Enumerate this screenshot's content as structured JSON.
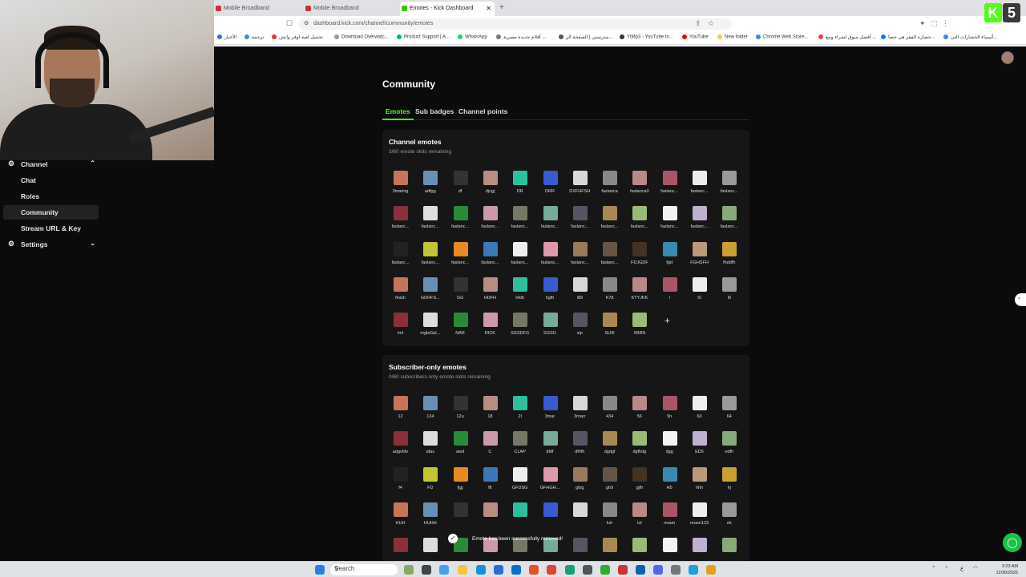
{
  "browser": {
    "tabs": [
      {
        "label": "Mobile Broadband",
        "active": false
      },
      {
        "label": "Mobile Broadband",
        "active": false
      },
      {
        "label": "Emotes - Kick Dashboard",
        "active": true
      }
    ],
    "url": "dashboard.kick.com/channel/community/emotes",
    "bookmarks": [
      "الأخبار",
      "ترجمة",
      "تحميل لعبة اوفر واتش",
      "Download Overwatc...",
      "Product Support | A...",
      "WhatsApp",
      "أفلام جديدة مصرية ...",
      "مدرستي | الصفحة الر...",
      "YtMp3 - YouTube to...",
      "YouTube",
      "New folder",
      "Chrome Web Store...",
      "أفضل سوق لشراء وبيع ...",
      "حصارة الفقر هي حصا...",
      "أسماء الحضارات التي..."
    ],
    "logo": {
      "letter": "K",
      "number": "5"
    }
  },
  "sidebar": {
    "items": [
      {
        "label": "Channel",
        "type": "parent",
        "icon": "gear-icon",
        "chevron": "⌃"
      },
      {
        "label": "Chat"
      },
      {
        "label": "Roles"
      },
      {
        "label": "Community",
        "active": true
      },
      {
        "label": "Stream URL & Key"
      },
      {
        "label": "Settings",
        "type": "parent",
        "icon": "gear-icon",
        "chevron": "⌄"
      }
    ]
  },
  "main": {
    "title": "Community",
    "tabs": [
      "Emotes",
      "Sub badges",
      "Channel points"
    ],
    "channel_emotes": {
      "heading": "Channel emotes",
      "slots": "3/60 emote slots remaining",
      "rows": [
        [
          "3maring",
          "adfgg",
          "df",
          "djcgj",
          "DR",
          "DRR",
          "DXFHFSH",
          "faslanca",
          "faslanca0",
          "faslanc...",
          "faslanc...",
          "faslanc..."
        ],
        [
          "faslanc...",
          "faslanc...",
          "faslanc...",
          "faslanc...",
          "faslanc...",
          "faslanc...",
          "faslanc...",
          "faslanc...",
          "faslanc...",
          "faslanc...",
          "faslanc...",
          "faslanc..."
        ],
        [
          "faslanc...",
          "faslanc...",
          "faslanc...",
          "faslanc...",
          "faslanc...",
          "faslanc...",
          "faslanc...",
          "faslanc...",
          "FDJGDF",
          "fgd",
          "FGHSFH",
          "fhddfh"
        ],
        [
          "finish",
          "GDHFS...",
          "GG",
          "HDFH",
          "hfdh",
          "hgfh",
          "i89",
          "K78",
          "KTYJKK",
          "l",
          "l0",
          "l9"
        ],
        [
          "iml",
          "mglsGal...",
          "NAR",
          "RICK",
          "SGSDFG",
          "SGSG",
          "sip",
          "SUIII",
          "XBBN"
        ]
      ],
      "add": "+"
    },
    "sub_emotes": {
      "heading": "Subscriber-only emotes",
      "slots": "0/60 subscribers only emote slots remaining",
      "rows": [
        [
          "12",
          "124",
          "12u",
          "18",
          "2l",
          "3mar",
          "3marr",
          "434",
          "56",
          "5h",
          "60",
          "64"
        ],
        [
          "adgvfdv",
          "afas",
          "awd",
          "C",
          "CLAP",
          "dfdf",
          "dfhfh",
          "dgdgf",
          "dgfhdg",
          "dgg",
          "ED5",
          "edfh"
        ],
        [
          "f4",
          "FD",
          "fjgj",
          "fft",
          "GFDSG",
          "GFHGH...",
          "gfsg",
          "gh9",
          "gjfh",
          "H5",
          "hhh",
          "hj"
        ],
        [
          "HUH",
          "HUHH",
          "",
          "",
          "",
          "",
          "",
          "luh",
          "lul",
          "mram",
          "mram123",
          "ok"
        ],
        [
          "",
          "",
          "",
          "",
          "",
          "",
          "",
          "",
          "",
          "",
          "",
          ""
        ]
      ]
    },
    "toast": "Emote has been successfully removed!"
  },
  "taskbar": {
    "search": "Search",
    "clock_time": "3:23 AM",
    "clock_date": "12/30/2025"
  },
  "emote_colors": [
    "#c7745a",
    "#6a8fb5",
    "#333",
    "#b98c84",
    "#2bc0a0",
    "#3a5ad0",
    "#d8d8d8",
    "#888",
    "#b88",
    "#a56",
    "#eee",
    "#999",
    "#8c2f3a",
    "#ddd",
    "#2a8a3a",
    "#c9a",
    "#776",
    "#7a9",
    "#556",
    "#a85",
    "#9b7",
    "#f2f2f2",
    "#c0b0d0",
    "#8a7",
    "#222",
    "#c2c530",
    "#e88a20",
    "#3a78b8",
    "#eee",
    "#d9a",
    "#9a7a5a",
    "#654",
    "#432",
    "#3a8ab0",
    "#b97",
    "#c9a030"
  ]
}
